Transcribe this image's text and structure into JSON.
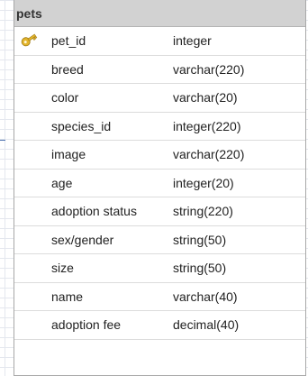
{
  "table": {
    "name": "pets",
    "columns": [
      {
        "name": "pet_id",
        "type": "integer",
        "primary_key": true
      },
      {
        "name": "breed",
        "type": "varchar(220)",
        "primary_key": false
      },
      {
        "name": "color",
        "type": "varchar(20)",
        "primary_key": false
      },
      {
        "name": "species_id",
        "type": "integer(220)",
        "primary_key": false
      },
      {
        "name": "image",
        "type": "varchar(220)",
        "primary_key": false
      },
      {
        "name": "age",
        "type": "integer(20)",
        "primary_key": false
      },
      {
        "name": "adoption status",
        "type": "string(220)",
        "primary_key": false
      },
      {
        "name": "sex/gender",
        "type": "string(50)",
        "primary_key": false
      },
      {
        "name": "size",
        "type": "string(50)",
        "primary_key": false
      },
      {
        "name": "name",
        "type": "varchar(40)",
        "primary_key": false
      },
      {
        "name": "adoption fee",
        "type": "decimal(40)",
        "primary_key": false
      }
    ]
  },
  "icons": {
    "primary_key": "key-icon"
  },
  "colors": {
    "header_background": "#d2d2d2",
    "border": "#a8a8a8",
    "row_divider": "#dcdcdc",
    "key_icon": "#e3b52c",
    "connector": "#4a6fae"
  }
}
